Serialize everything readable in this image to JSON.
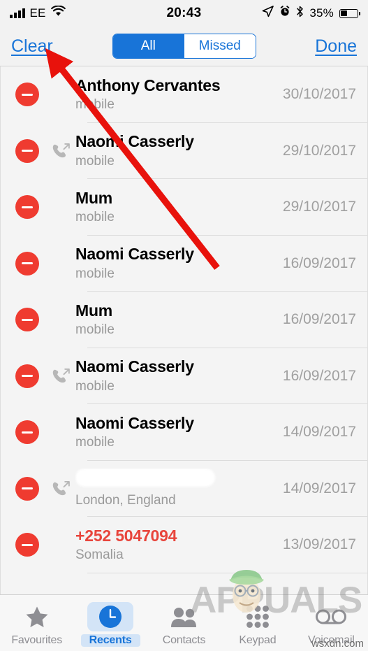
{
  "status_bar": {
    "signal_bars": 4,
    "carrier": "EE",
    "wifi_icon": "wifi-icon",
    "time": "20:43",
    "location_icon": "location-arrow-icon",
    "alarm_icon": "alarm-clock-icon",
    "bluetooth_icon": "bluetooth-icon",
    "battery_percent": "35%",
    "battery_level": 35
  },
  "nav_bar": {
    "clear_label": "Clear",
    "done_label": "Done",
    "segments": [
      {
        "label": "All",
        "selected": true
      },
      {
        "label": "Missed",
        "selected": false
      }
    ]
  },
  "colors": {
    "accent_blue": "#1874d8",
    "delete_red": "#ef3b30",
    "missed_red": "#e8453c",
    "list_bg": "#f4f4f4",
    "secondary_text": "#9a9a9a"
  },
  "call_list": [
    {
      "name": "Anthony Cervantes",
      "subtitle": "mobile",
      "date": "30/10/2017",
      "direction": "none",
      "missed": false,
      "redacted": false
    },
    {
      "name": "Naomi Casserly",
      "subtitle": "mobile",
      "date": "29/10/2017",
      "direction": "outgoing",
      "missed": false,
      "redacted": false
    },
    {
      "name": "Mum",
      "subtitle": "mobile",
      "date": "29/10/2017",
      "direction": "none",
      "missed": false,
      "redacted": false
    },
    {
      "name": "Naomi Casserly",
      "subtitle": "mobile",
      "date": "16/09/2017",
      "direction": "none",
      "missed": false,
      "redacted": false
    },
    {
      "name": "Mum",
      "subtitle": "mobile",
      "date": "16/09/2017",
      "direction": "none",
      "missed": false,
      "redacted": false
    },
    {
      "name": "Naomi Casserly",
      "subtitle": "mobile",
      "date": "16/09/2017",
      "direction": "outgoing",
      "missed": false,
      "redacted": false
    },
    {
      "name": "Naomi Casserly",
      "subtitle": "mobile",
      "date": "14/09/2017",
      "direction": "none",
      "missed": false,
      "redacted": false
    },
    {
      "name": "",
      "subtitle": "London, England",
      "date": "14/09/2017",
      "direction": "outgoing",
      "missed": false,
      "redacted": true
    },
    {
      "name": "+252 5047094",
      "subtitle": "Somalia",
      "date": "13/09/2017",
      "direction": "none",
      "missed": true,
      "redacted": false
    }
  ],
  "delete_button_label": "remove",
  "tab_bar": [
    {
      "label": "Favourites",
      "icon": "star-icon",
      "selected": false
    },
    {
      "label": "Recents",
      "icon": "clock-icon",
      "selected": true
    },
    {
      "label": "Contacts",
      "icon": "people-icon",
      "selected": false
    },
    {
      "label": "Keypad",
      "icon": "keypad-dots-icon",
      "selected": false
    },
    {
      "label": "Voicemail",
      "icon": "voicemail-icon",
      "selected": false
    }
  ],
  "annotation": {
    "arrow_color": "#e8120c",
    "points_at": "Clear"
  },
  "watermark": {
    "brand": "APPUALS",
    "site": "wsxdn.com"
  }
}
